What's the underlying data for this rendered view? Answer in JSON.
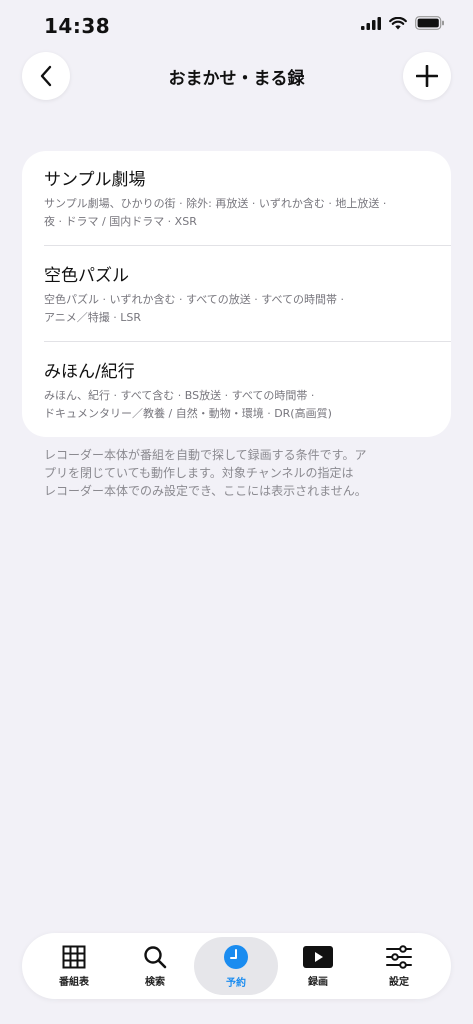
{
  "status_bar": {
    "time": "14:38"
  },
  "nav": {
    "title": "おまかせ・まる録",
    "back_icon": "chevron-left-icon",
    "add_icon": "plus-icon"
  },
  "rules": [
    {
      "title": "サンプル劇場",
      "detail_line1": "サンプル劇場、ひかりの街 · 除外: 再放送 · いずれか含む · 地上放送 ·",
      "detail_line2": "夜 · ドラマ / 国内ドラマ · XSR"
    },
    {
      "title": "空色パズル",
      "detail_line1": "空色パズル · いずれか含む · すべての放送 · すべての時間帯 ·",
      "detail_line2": "アニメ／特撮 · LSR"
    },
    {
      "title": "みほん/紀行",
      "detail_line1": "みほん、紀行 · すべて含む · BS放送 · すべての時間帯 ·",
      "detail_line2": "ドキュメンタリー／教養 / 自然・動物・環境 · DR(高画質)"
    }
  ],
  "footnote": {
    "line1": "レコーダー本体が番組を自動で探して録画する条件です。ア",
    "line2": "プリを閉じていても動作します。対象チャンネルの指定は",
    "line3": "レコーダー本体でのみ設定でき、ここには表示されません。"
  },
  "tabs": [
    {
      "label": "番組表",
      "icon": "grid-icon"
    },
    {
      "label": "検索",
      "icon": "search-icon"
    },
    {
      "label": "予約",
      "icon": "clock-icon",
      "active": true
    },
    {
      "label": "録画",
      "icon": "play-icon"
    },
    {
      "label": "設定",
      "icon": "sliders-icon"
    }
  ],
  "colors": {
    "accent": "#1a8cf0",
    "background": "#f2f1f7"
  }
}
